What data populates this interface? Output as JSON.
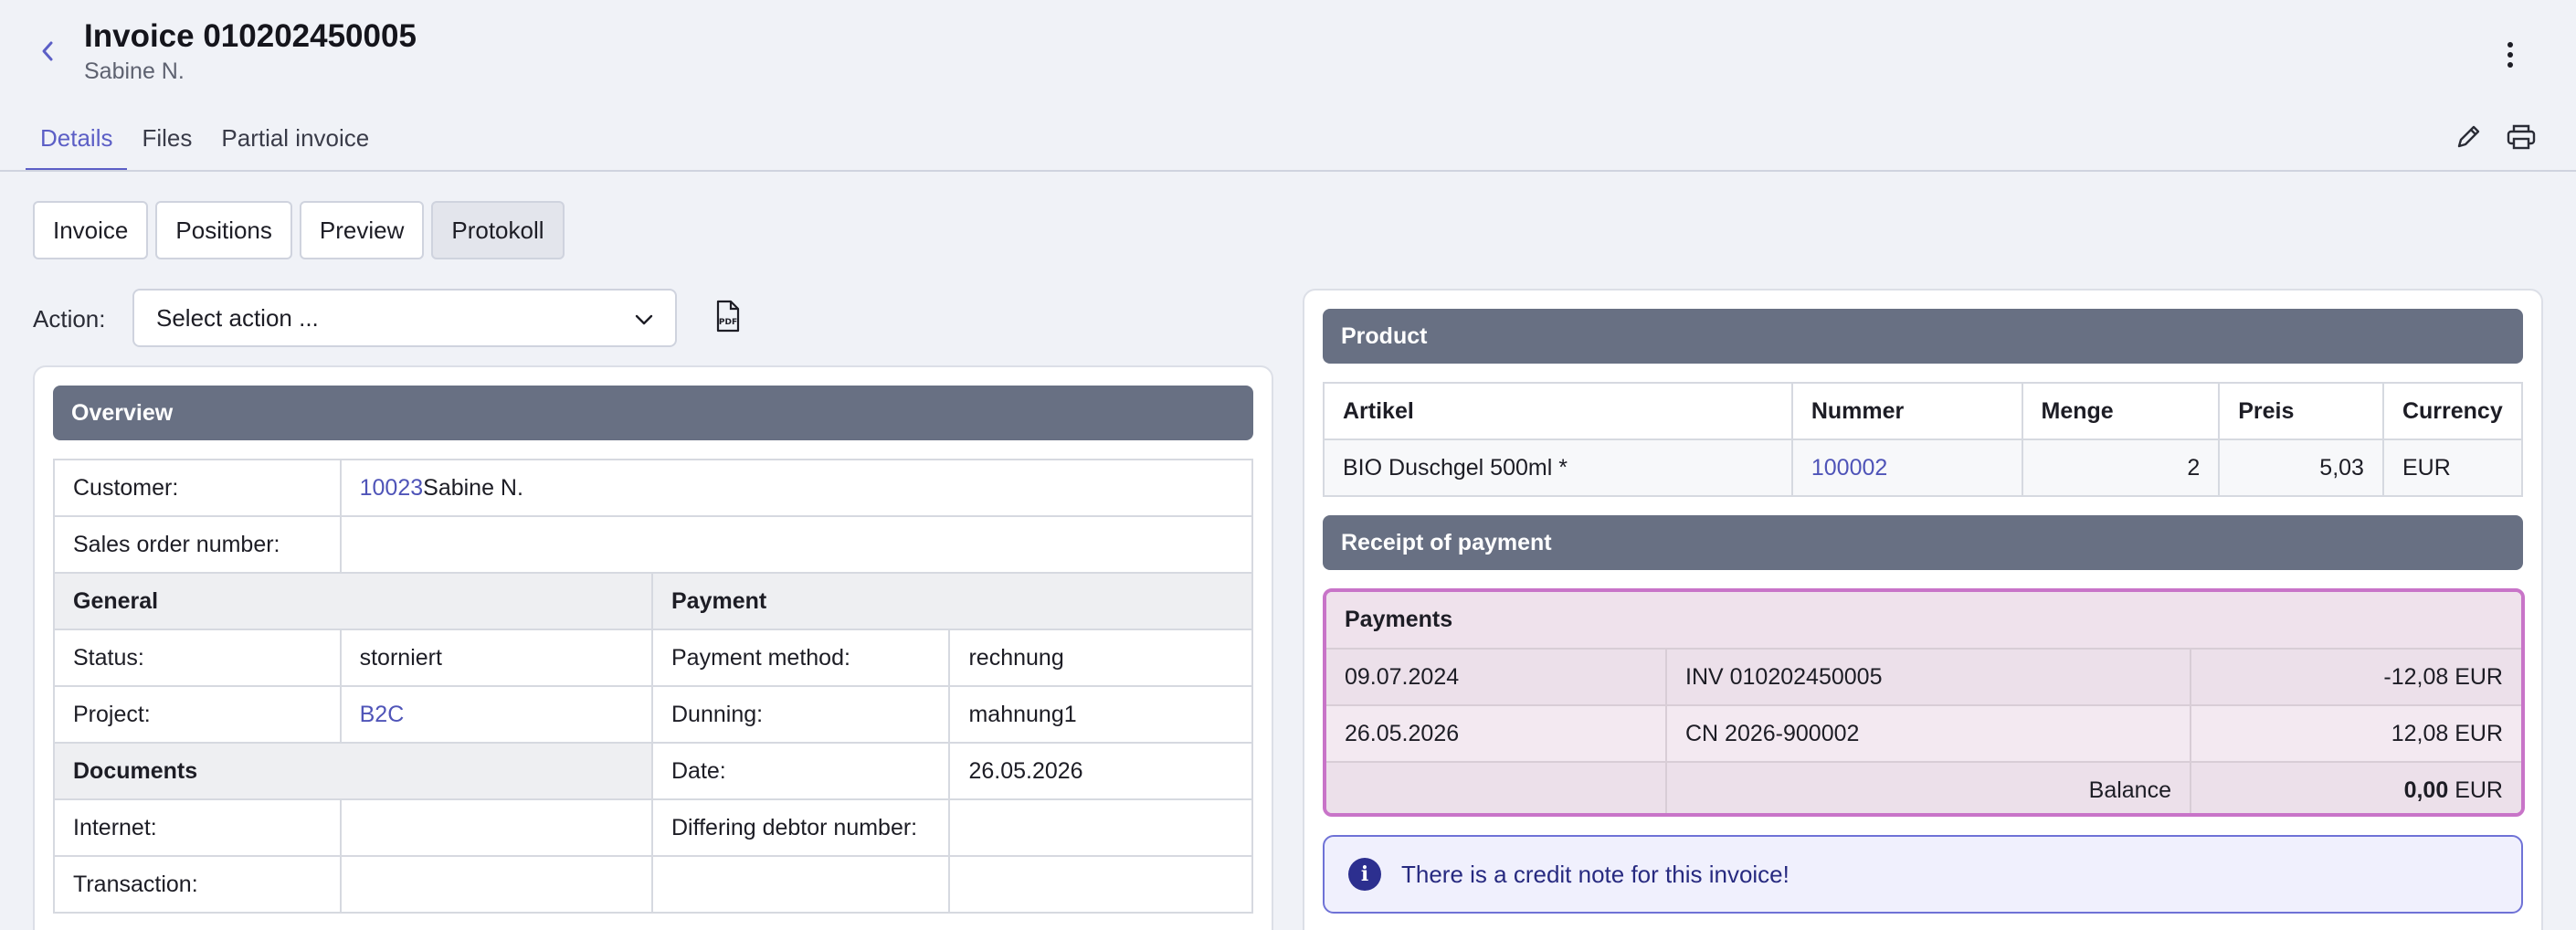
{
  "header": {
    "title": "Invoice 010202450005",
    "subtitle": "Sabine N.",
    "back_icon": "chevron-left-icon",
    "menu_icon": "kebab-vertical-icon"
  },
  "tabs": [
    {
      "label": "Details",
      "active": true
    },
    {
      "label": "Files",
      "active": false
    },
    {
      "label": "Partial invoice",
      "active": false
    }
  ],
  "toolbar": {
    "edit_icon": "pencil-icon",
    "print_icon": "printer-icon"
  },
  "subtabs": [
    {
      "label": "Invoice",
      "active": false
    },
    {
      "label": "Positions",
      "active": false
    },
    {
      "label": "Preview",
      "active": false
    },
    {
      "label": "Protokoll",
      "active": true
    }
  ],
  "action": {
    "label": "Action:",
    "selected": "Select action ...",
    "pdf_icon": "pdf-file-icon"
  },
  "overview": {
    "heading": "Overview",
    "customer_label": "Customer:",
    "customer_id": "10023",
    "customer_name": "Sabine N.",
    "sales_order_label": "Sales order number:",
    "sales_order_value": "",
    "general_heading": "General",
    "payment_heading": "Payment",
    "status_label": "Status:",
    "status_value": "storniert",
    "payment_method_label": "Payment method:",
    "payment_method_value": "rechnung",
    "project_label": "Project:",
    "project_value": "B2C",
    "dunning_label": "Dunning:",
    "dunning_value": "mahnung1",
    "documents_heading": "Documents",
    "date_label": "Date:",
    "date_value": "26.05.2026",
    "internet_label": "Internet:",
    "internet_value": "",
    "differing_debtor_label": "Differing debtor number:",
    "differing_debtor_value": "",
    "transaction_label": "Transaction:",
    "transaction_value": ""
  },
  "product": {
    "heading": "Product",
    "columns": [
      "Artikel",
      "Nummer",
      "Menge",
      "Preis",
      "Currency"
    ],
    "rows": [
      {
        "artikel": "BIO Duschgel 500ml *",
        "nummer": "100002",
        "menge": "2",
        "preis": "5,03",
        "currency": "EUR"
      }
    ]
  },
  "receipt": {
    "heading": "Receipt of payment",
    "payments_heading": "Payments",
    "rows": [
      {
        "date": "09.07.2024",
        "doc": "INV 010202450005",
        "amount": "-12,08 EUR"
      },
      {
        "date": "26.05.2026",
        "doc": "CN 2026-900002",
        "amount": "12,08 EUR"
      }
    ],
    "balance_label": "Balance",
    "balance_value": "0,00",
    "balance_currency": "EUR"
  },
  "info": {
    "icon": "info-icon",
    "message": "There is a credit note for this invoice!"
  }
}
